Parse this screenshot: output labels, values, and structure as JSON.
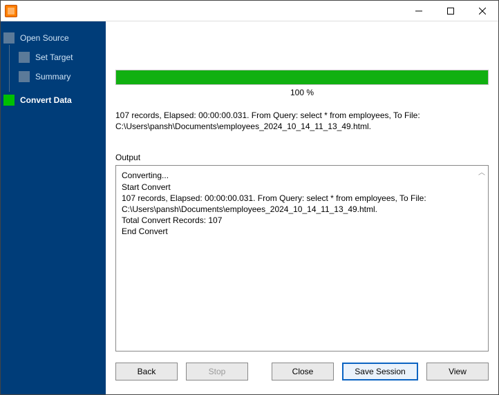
{
  "window": {
    "title": ""
  },
  "sidebar": {
    "items": [
      {
        "label": "Open Source"
      },
      {
        "label": "Set Target"
      },
      {
        "label": "Summary"
      },
      {
        "label": "Convert Data"
      }
    ]
  },
  "progress": {
    "percent_text": "100 %",
    "fill_percent": 100
  },
  "status": {
    "line": "107 records,    Elapsed: 00:00:00.031.    From Query: select * from employees,    To File: C:\\Users\\pansh\\Documents\\employees_2024_10_14_11_13_49.html."
  },
  "output": {
    "label": "Output",
    "lines": [
      "Converting...",
      "Start Convert",
      "107 records,    Elapsed: 00:00:00.031.    From Query: select * from employees,    To File: C:\\Users\\pansh\\Documents\\employees_2024_10_14_11_13_49.html.",
      "Total Convert Records: 107",
      "End Convert"
    ]
  },
  "buttons": {
    "back": "Back",
    "stop": "Stop",
    "close": "Close",
    "save_session": "Save Session",
    "view": "View"
  }
}
